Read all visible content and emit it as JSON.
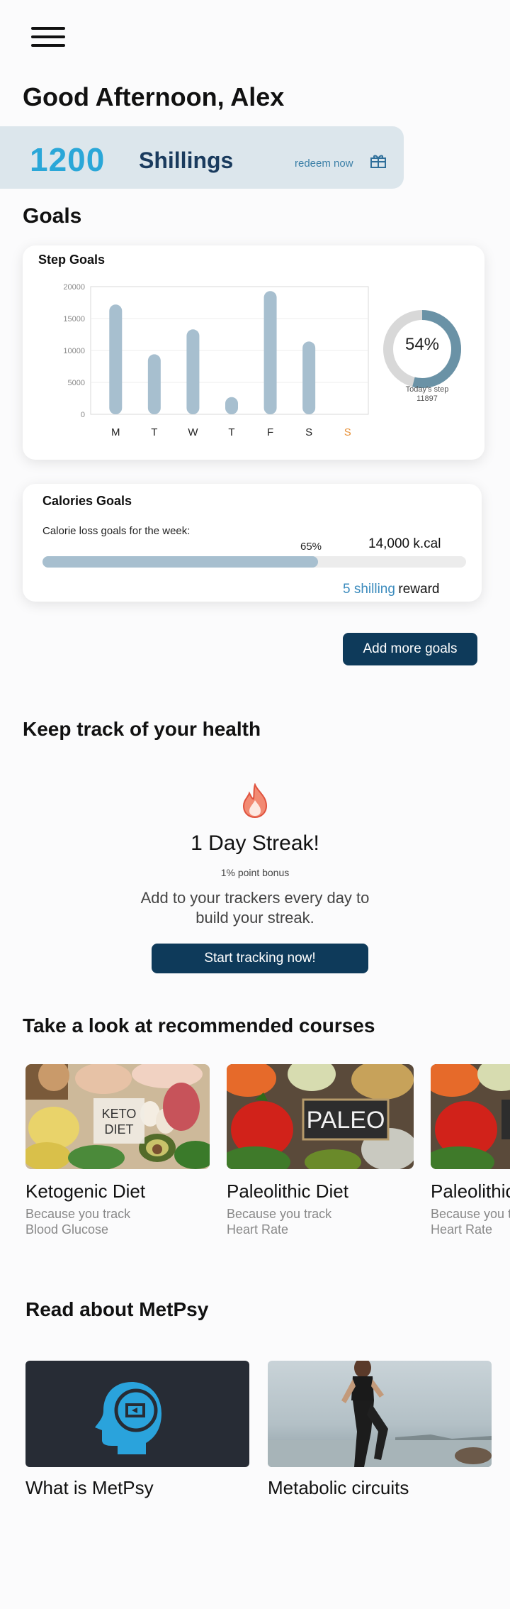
{
  "header": {
    "menu_icon": "hamburger-menu-icon",
    "greeting": "Good Afternoon, Alex"
  },
  "balance": {
    "amount": "1200",
    "unit": "Shillings",
    "redeem_label": "redeem now",
    "redeem_icon": "gift-icon"
  },
  "goals": {
    "title": "Goals",
    "step_goals": {
      "title": "Step Goals",
      "today_percent": "54%",
      "today_label": "Today's step",
      "today_steps": "11897",
      "today_fraction": 0.54,
      "ring_color": "#6a92a6",
      "ring_track_color": "#d8d8d8"
    },
    "calories": {
      "title": "Calories Goals",
      "subtitle": "Calorie loss goals for the week:",
      "percent_label": "65%",
      "progress": 0.65,
      "target": "14,000 k.cal",
      "reward_amount": "5 shilling",
      "reward_word": "reward"
    },
    "add_button": "Add more goals"
  },
  "chart_data": {
    "type": "bar",
    "title": "Step Goals",
    "categories": [
      "M",
      "T",
      "W",
      "T",
      "F",
      "S",
      "S"
    ],
    "values": [
      17200,
      9400,
      13300,
      2700,
      19300,
      11400,
      0
    ],
    "ylim": [
      0,
      20000
    ],
    "yticks": [
      0,
      5000,
      10000,
      15000,
      20000
    ],
    "grid": true,
    "bar_color": "#a7bfcf",
    "highlight_color": "#e8923a",
    "highlight_index": 6
  },
  "health": {
    "title": "Keep track of your health",
    "streak_icon": "flame-icon",
    "streak_title": "1 Day Streak!",
    "bonus": "1% point bonus",
    "description_line1": "Add to your trackers every day to",
    "description_line2": "build your streak.",
    "cta": "Start tracking now!"
  },
  "courses": {
    "title": "Take a look at recommended courses",
    "items": [
      {
        "title": "Ketogenic Diet",
        "reason_line1": "Because you track",
        "reason_line2": "Blood Glucose",
        "image_label_1": "KETO",
        "image_label_2": "DIET"
      },
      {
        "title": "Paleolithic Diet",
        "reason_line1": "Because you track",
        "reason_line2": "Heart Rate",
        "image_label_1": "PALEO"
      },
      {
        "title": "Paleolithic Diet",
        "reason_line1": "Because you track",
        "reason_line2": "Heart Rate"
      }
    ]
  },
  "articles": {
    "title": "Read about MetPsy",
    "items": [
      {
        "title": "What is MetPsy",
        "icon": "brain-head-icon"
      },
      {
        "title": "Metabolic circuits",
        "icon": "runner-photo"
      }
    ]
  }
}
